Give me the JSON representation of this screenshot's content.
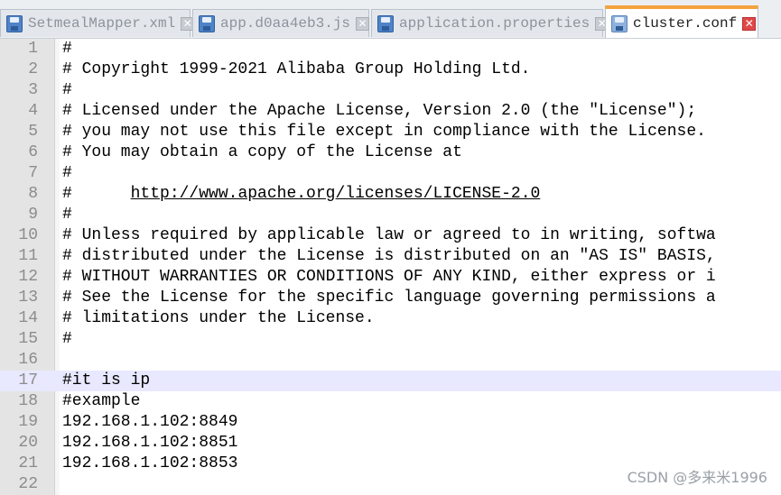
{
  "tabs": [
    {
      "label": "SetmealMapper.xml",
      "active": false
    },
    {
      "label": "app.d0aa4eb3.js",
      "active": false
    },
    {
      "label": "application.properties",
      "active": false
    },
    {
      "label": "cluster.conf",
      "active": true
    }
  ],
  "editor": {
    "current_line": 17,
    "lines": [
      {
        "num": "1",
        "text": "#"
      },
      {
        "num": "2",
        "text": "# Copyright 1999-2021 Alibaba Group Holding Ltd."
      },
      {
        "num": "3",
        "text": "#"
      },
      {
        "num": "4",
        "text": "# Licensed under the Apache License, Version 2.0 (the \"License\");"
      },
      {
        "num": "5",
        "text": "# you may not use this file except in compliance with the License."
      },
      {
        "num": "6",
        "text": "# You may obtain a copy of the License at"
      },
      {
        "num": "7",
        "text": "#"
      },
      {
        "num": "8",
        "prefix": "#      ",
        "link": "http://www.apache.org/licenses/LICENSE-2.0"
      },
      {
        "num": "9",
        "text": "#"
      },
      {
        "num": "10",
        "text": "# Unless required by applicable law or agreed to in writing, softwa"
      },
      {
        "num": "11",
        "text": "# distributed under the License is distributed on an \"AS IS\" BASIS,"
      },
      {
        "num": "12",
        "text": "# WITHOUT WARRANTIES OR CONDITIONS OF ANY KIND, either express or i"
      },
      {
        "num": "13",
        "text": "# See the License for the specific language governing permissions a"
      },
      {
        "num": "14",
        "text": "# limitations under the License."
      },
      {
        "num": "15",
        "text": "#"
      },
      {
        "num": "16",
        "text": ""
      },
      {
        "num": "17",
        "text": "#it is ip"
      },
      {
        "num": "18",
        "text": "#example"
      },
      {
        "num": "19",
        "text": "192.168.1.102:8849"
      },
      {
        "num": "20",
        "text": "192.168.1.102:8851"
      },
      {
        "num": "21",
        "text": "192.168.1.102:8853"
      },
      {
        "num": "22",
        "text": ""
      }
    ]
  },
  "watermark": "CSDN @多来米1996",
  "colors": {
    "active_tab_accent": "#f4a23c",
    "current_line_highlight": "#e8e8ff",
    "close_button_active": "#e04848"
  },
  "icons": {
    "tab_file": "save-disk-icon",
    "tab_close": "close-icon"
  }
}
